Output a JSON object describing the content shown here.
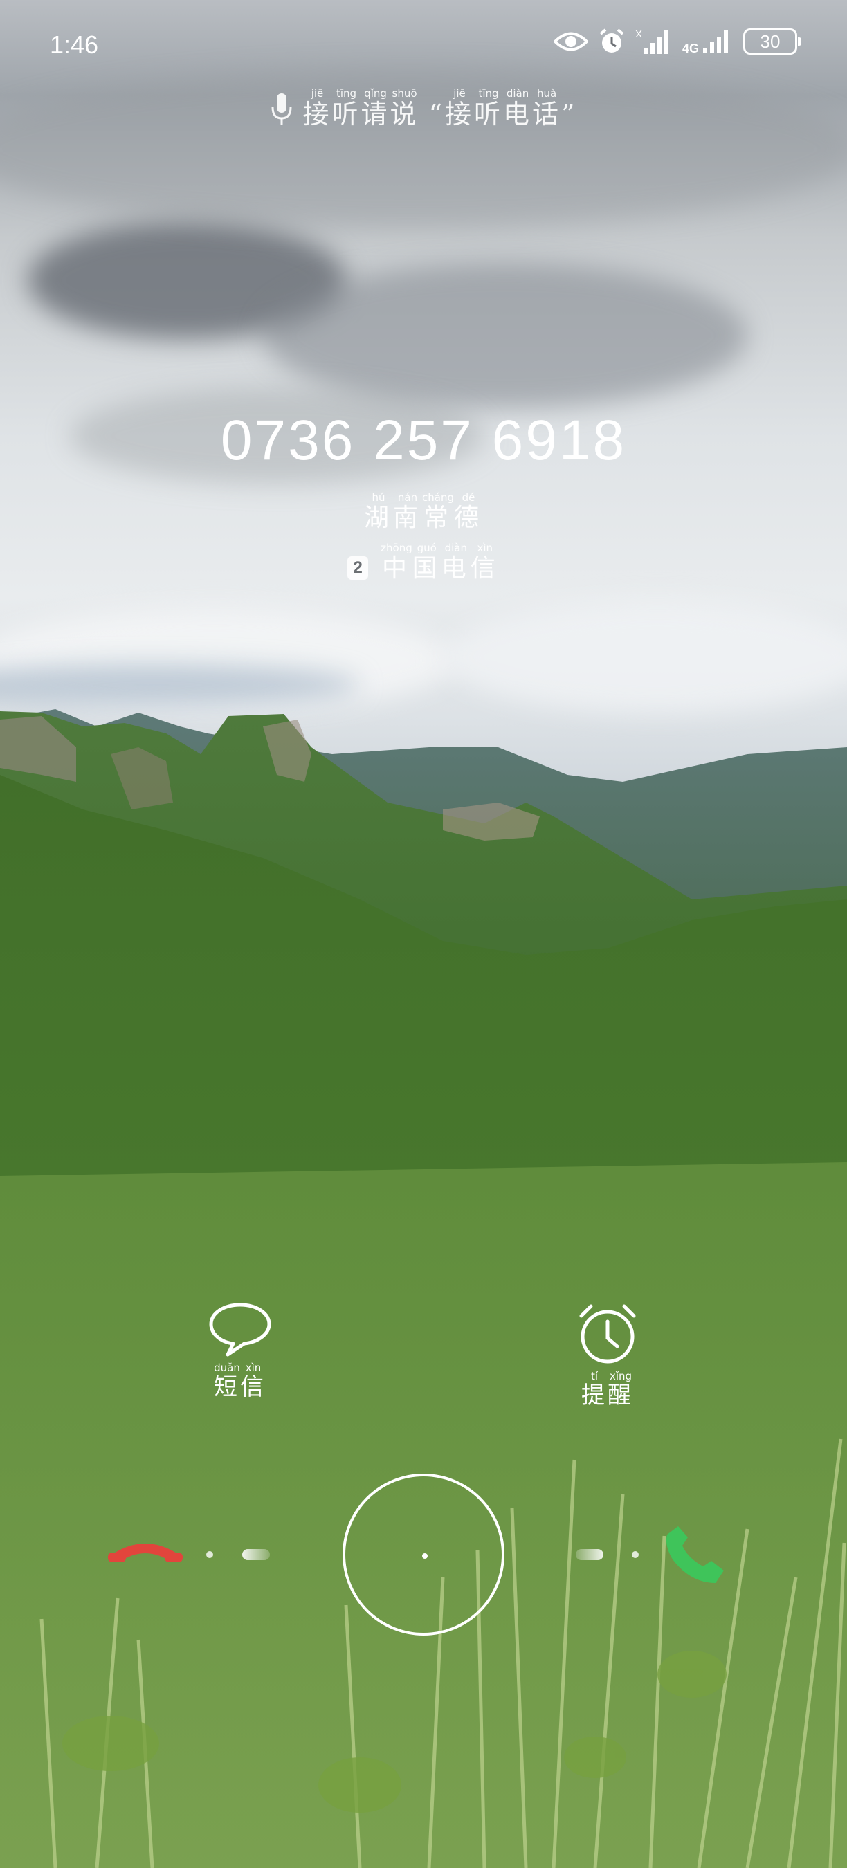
{
  "status_bar": {
    "time": "1:46",
    "battery": "30",
    "network": "4G",
    "icons": [
      "eye-icon",
      "alarm-icon",
      "signal-icon",
      "signal-4g-icon",
      "battery-icon"
    ]
  },
  "voice_hint": {
    "prefix": [
      {
        "char": "接",
        "pinyin": "jiē"
      },
      {
        "char": "听",
        "pinyin": "tīng"
      },
      {
        "char": "请",
        "pinyin": "qǐng"
      },
      {
        "char": "说",
        "pinyin": "shuō"
      }
    ],
    "open_quote": "“",
    "command": [
      {
        "char": "接",
        "pinyin": "jiē"
      },
      {
        "char": "听",
        "pinyin": "tīng"
      },
      {
        "char": "电",
        "pinyin": "diàn"
      },
      {
        "char": "话",
        "pinyin": "huà"
      }
    ],
    "close_quote": "”"
  },
  "caller": {
    "number": "0736 257 6918",
    "location": [
      {
        "char": "湖",
        "pinyin": "hú"
      },
      {
        "char": "南",
        "pinyin": "nán"
      },
      {
        "char": "常",
        "pinyin": "cháng"
      },
      {
        "char": "德",
        "pinyin": "dé"
      }
    ],
    "sim_slot": "2",
    "carrier": [
      {
        "char": "中",
        "pinyin": "zhōng"
      },
      {
        "char": "国",
        "pinyin": "guó"
      },
      {
        "char": "电",
        "pinyin": "diàn"
      },
      {
        "char": "信",
        "pinyin": "xìn"
      }
    ]
  },
  "actions": {
    "message": {
      "label": [
        {
          "char": "短",
          "pinyin": "duǎn"
        },
        {
          "char": "信",
          "pinyin": "xìn"
        }
      ],
      "icon": "message-bubble-icon"
    },
    "remind": {
      "label": [
        {
          "char": "提",
          "pinyin": "tí"
        },
        {
          "char": "醒",
          "pinyin": "xǐng"
        }
      ],
      "icon": "alarm-clock-icon"
    }
  },
  "slider": {
    "decline_icon": "decline-phone-icon",
    "accept_icon": "accept-phone-icon"
  },
  "colors": {
    "decline": "#e2453c",
    "accept": "#3fc45a"
  }
}
